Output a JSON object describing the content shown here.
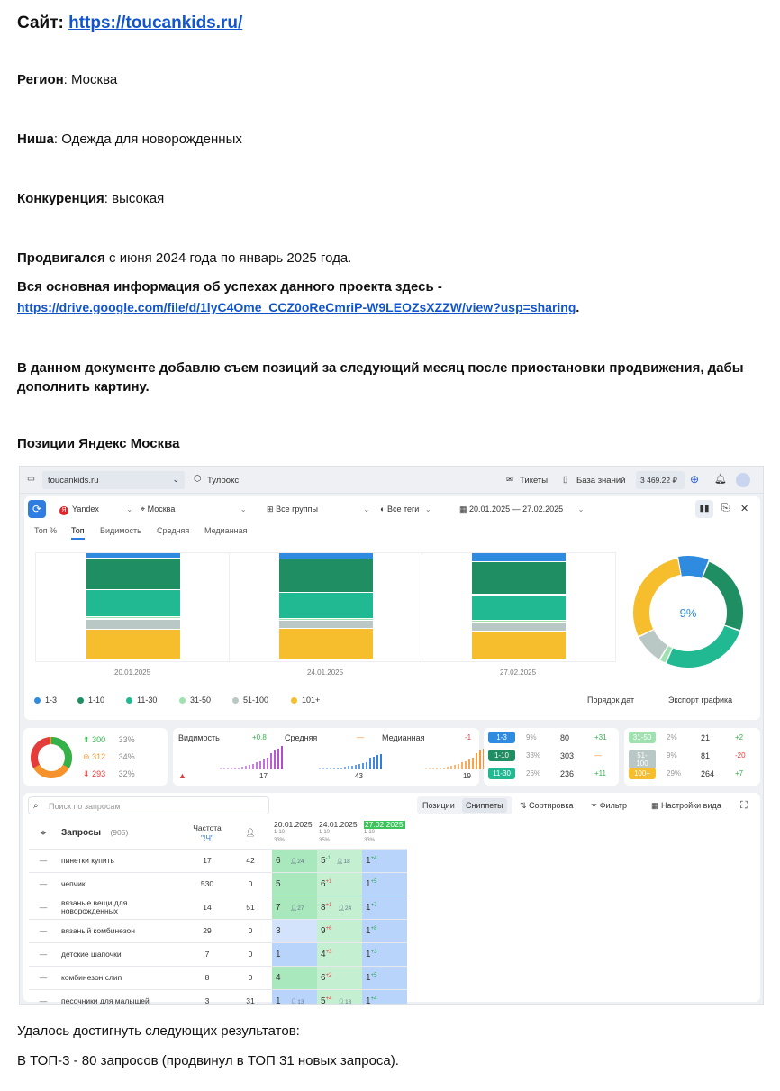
{
  "doc": {
    "site_label": "Сайт:",
    "site_url": "https://toucankids.ru/",
    "region_label": "Регион",
    "region_value": ": Москва",
    "niche_label": "Ниша",
    "niche_value": ": Одежда для новорожденных",
    "competition_label": "Конкуренция",
    "competition_value": ": высокая",
    "promo_label": "Продвигался",
    "promo_value": " с июня 2024 года по январь 2025 года.",
    "info_text": "Вся основная информация об успехах данного проекта здесь -",
    "info_url": "https://drive.google.com/file/d/1lyC4Ome_CCZ0oReCmriP-W9LEOZsXZZW/view?usp=sharing",
    "info_dot": ".",
    "note": "В данном документе добавлю съем позиций за следующий месяц после приостановки продвижения, дабы дополнить картину.",
    "positions_title": "Позиции Яндекс Москва",
    "achieve": "Удалось достигнуть следующих результатов:",
    "top3": "В ТОП-3 - 80 запросов (продвинул в ТОП 31 новых запроса)."
  },
  "app": {
    "project": "toucankids.ru",
    "toolbox": "Тулбокс",
    "tickets": "Тикеты",
    "knowledge": "База знаний",
    "balance": "3 469.22 ₽",
    "engine": "Yandex",
    "city": "Москва",
    "groups": "Все группы",
    "tags": "Все теги",
    "dates": "20.01.2025 — 27.02.2025",
    "tabs": [
      "Топ %",
      "Топ",
      "Видимость",
      "Средняя",
      "Медианная"
    ],
    "chart_dates": [
      "20.01.2025",
      "24.01.2025",
      "27.02.2025"
    ],
    "donut_label": "9%",
    "legend": [
      "1-3",
      "1-10",
      "11-30",
      "31-50",
      "51-100",
      "101+"
    ],
    "order_btn": "Порядок дат",
    "export_btn": "Экспорт графика",
    "summary": {
      "up": "300",
      "up_pct": "33%",
      "eq": "312",
      "eq_pct": "34%",
      "down": "293",
      "down_pct": "32%"
    },
    "metrics": [
      {
        "name": "Видимость",
        "delta": "+0.8",
        "value": "17"
      },
      {
        "name": "Средняя",
        "delta": "—",
        "value": "43"
      },
      {
        "name": "Медианная",
        "delta": "-1",
        "value": "19"
      }
    ],
    "groups_stats": [
      {
        "range": "1-3",
        "pct": "9%",
        "val": "80",
        "delta": "+31"
      },
      {
        "range": "1-10",
        "pct": "33%",
        "val": "303",
        "delta": "—"
      },
      {
        "range": "11-30",
        "pct": "26%",
        "val": "236",
        "delta": "+11"
      },
      {
        "range": "31-50",
        "pct": "2%",
        "val": "21",
        "delta": "+2"
      },
      {
        "range": "51-100",
        "pct": "9%",
        "val": "81",
        "delta": "-20"
      },
      {
        "range": "100+",
        "pct": "29%",
        "val": "264",
        "delta": "+7"
      }
    ],
    "search_placeholder": "Поиск по запросам",
    "positions_btn": "Позиции",
    "snippets_btn": "Сниппеты",
    "sort_btn": "Сортировка",
    "filter_btn": "Фильтр",
    "view_btn": "Настройки вида",
    "col_queries": "Запросы",
    "col_count": "(905)",
    "col_freq": "Частота",
    "col_freq_sub": "\"!Ч\"",
    "col_dates": [
      "20.01.2025",
      "24.01.2025",
      "27.02.2025"
    ],
    "col_sub": [
      "1-10",
      "1-10",
      "1-10"
    ],
    "col_pct": [
      "33%",
      "35%",
      "33%"
    ],
    "rows": [
      {
        "q": "пинетки купить",
        "f": "17",
        "u": "42",
        "p1": "6",
        "s1": "24",
        "p2": "5",
        "d2": "-1",
        "s2": "18",
        "p3": "1",
        "d3": "+4"
      },
      {
        "q": "чепчик",
        "f": "530",
        "u": "0",
        "p1": "5",
        "s1": "",
        "p2": "6",
        "d2": "+1",
        "s2": "",
        "p3": "1",
        "d3": "+5"
      },
      {
        "q": "вязаные вещи для новорожденных",
        "f": "14",
        "u": "51",
        "p1": "7",
        "s1": "27",
        "p2": "8",
        "d2": "+1",
        "s2": "24",
        "p3": "1",
        "d3": "+7"
      },
      {
        "q": "вязаный комбинезон",
        "f": "29",
        "u": "0",
        "p1": "3",
        "s1": "",
        "p2": "9",
        "d2": "+6",
        "s2": "",
        "p3": "1",
        "d3": "+8"
      },
      {
        "q": "детские шапочки",
        "f": "7",
        "u": "0",
        "p1": "1",
        "s1": "",
        "p2": "4",
        "d2": "+3",
        "s2": "",
        "p3": "1",
        "d3": "+3"
      },
      {
        "q": "комбинезон слип",
        "f": "8",
        "u": "0",
        "p1": "4",
        "s1": "",
        "p2": "6",
        "d2": "+2",
        "s2": "",
        "p3": "1",
        "d3": "+5"
      },
      {
        "q": "песочники для малышей",
        "f": "3",
        "u": "31",
        "p1": "1",
        "s1": "13",
        "p2": "5",
        "d2": "+4",
        "s2": "18",
        "p3": "1",
        "d3": "+4"
      }
    ]
  },
  "chart_data": {
    "type": "bar",
    "categories": [
      "20.01.2025",
      "24.01.2025",
      "27.02.2025"
    ],
    "series": [
      {
        "name": "1-3",
        "color": "#2f8be0",
        "values": [
          5,
          6,
          9
        ]
      },
      {
        "name": "1-10",
        "color": "#1f8f63",
        "values": [
          32,
          33,
          34
        ]
      },
      {
        "name": "11-30",
        "color": "#20b992",
        "values": [
          27,
          25,
          26
        ]
      },
      {
        "name": "31-50",
        "color": "#9fe2b0",
        "values": [
          2,
          2,
          2
        ]
      },
      {
        "name": "51-100",
        "color": "#b9c7c5",
        "values": [
          10,
          8,
          9
        ]
      },
      {
        "name": "101+",
        "color": "#f6bd2c",
        "values": [
          30,
          30,
          29
        ]
      }
    ],
    "donut": {
      "values": [
        9,
        24,
        26,
        2,
        9,
        29
      ],
      "label": "9%"
    }
  }
}
